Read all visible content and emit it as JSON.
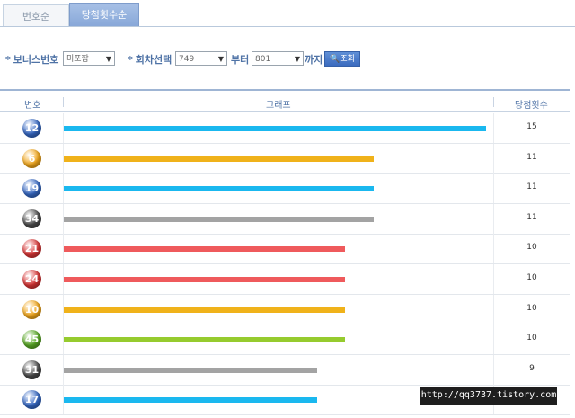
{
  "tabs": [
    {
      "label": "번호순"
    },
    {
      "label": "당첨횟수순"
    }
  ],
  "filters": {
    "bonus_label": "보너스번호",
    "bonus_value": "미포함",
    "round_label": "회차선택",
    "round_from": "749",
    "from_suffix": "부터",
    "round_to": "801",
    "to_suffix": "까지",
    "search_label": "조회"
  },
  "table": {
    "headers": {
      "number": "번호",
      "graph": "그래프",
      "count": "당첨횟수"
    }
  },
  "chart_data": {
    "type": "bar",
    "orientation": "horizontal",
    "categories": [
      "12",
      "6",
      "19",
      "34",
      "21",
      "24",
      "10",
      "45",
      "31",
      "17"
    ],
    "values": [
      15,
      11,
      11,
      11,
      10,
      10,
      10,
      10,
      9,
      9
    ],
    "bar_colors": [
      "#1ab8ef",
      "#f0b21a",
      "#1ab8ef",
      "#a3a3a3",
      "#ef5a5c",
      "#ef5a5c",
      "#f0b21a",
      "#96cb2e",
      "#a3a3a3",
      "#1ab8ef"
    ],
    "ball_colors": [
      "#3568c4",
      "#f3a81c",
      "#3568c4",
      "#4a4a4a",
      "#d93636",
      "#d93636",
      "#f3a81c",
      "#5aaa26",
      "#4a4a4a",
      "#3568c4"
    ],
    "visible_count_labels": [
      "15",
      "11",
      "11",
      "11",
      "10",
      "10",
      "10",
      "10",
      "9"
    ],
    "xlim": [
      0,
      15
    ]
  },
  "watermark": "http://qq3737.tistory.com"
}
